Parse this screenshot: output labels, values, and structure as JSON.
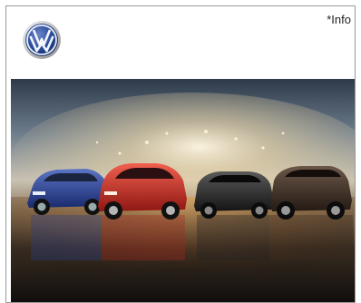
{
  "ad": {
    "brand": "VW",
    "info_link": "*Info"
  },
  "colors": {
    "vw_blue": "#1d3f8c",
    "accent_red": "#c0272d"
  },
  "icons": {
    "logo": "vw-logo-icon"
  }
}
